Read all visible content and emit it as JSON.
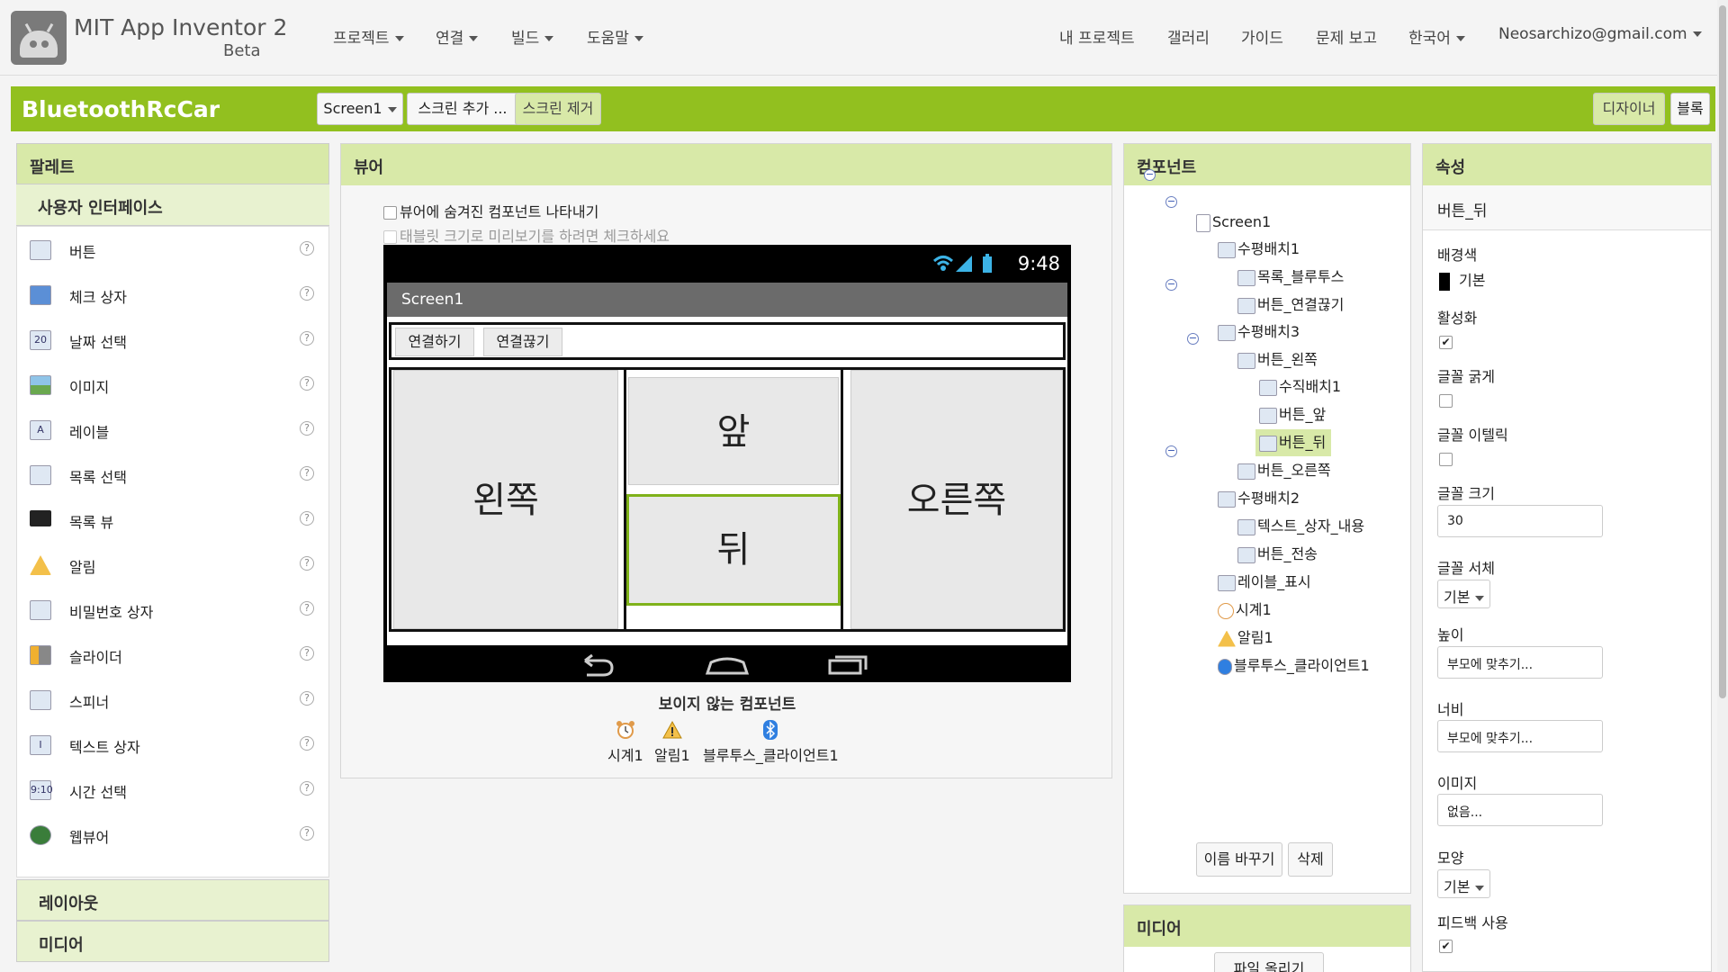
{
  "header": {
    "app_title": "MIT App Inventor 2",
    "app_subtitle": "Beta",
    "menus": [
      "프로젝트",
      "연결",
      "빌드",
      "도움말"
    ],
    "links": [
      "내 프로젝트",
      "갤러리",
      "가이드",
      "문제 보고"
    ],
    "language": "한국어",
    "account": "Neosarchizo@gmail.com"
  },
  "projbar": {
    "project_name": "BluetoothRcCar",
    "screen_select": "Screen1",
    "add_screen": "스크린 추가 ...",
    "remove_screen": "스크린 제거",
    "designer": "디자이너",
    "blocks": "블록"
  },
  "palette": {
    "title": "팔레트",
    "category_open": "사용자 인터페이스",
    "items": [
      {
        "label": "버튼",
        "icon": "button-icon"
      },
      {
        "label": "체크 상자",
        "icon": "checkbox-icon"
      },
      {
        "label": "날짜 선택",
        "icon": "datepicker-icon"
      },
      {
        "label": "이미지",
        "icon": "image-icon"
      },
      {
        "label": "레이블",
        "icon": "label-icon"
      },
      {
        "label": "목록 선택",
        "icon": "listpicker-icon"
      },
      {
        "label": "목록 뷰",
        "icon": "listview-icon"
      },
      {
        "label": "알림",
        "icon": "notifier-icon"
      },
      {
        "label": "비밀번호 상자",
        "icon": "password-icon"
      },
      {
        "label": "슬라이더",
        "icon": "slider-icon"
      },
      {
        "label": "스피너",
        "icon": "spinner-icon"
      },
      {
        "label": "텍스트 상자",
        "icon": "textbox-icon"
      },
      {
        "label": "시간 선택",
        "icon": "timepicker-icon"
      },
      {
        "label": "웹뷰어",
        "icon": "webviewer-icon"
      }
    ],
    "help_glyph": "?",
    "cat_layout": "레이아웃",
    "cat_media": "미디어"
  },
  "viewer": {
    "title": "뷰어",
    "opt_hidden": "뷰어에 숨겨진 컴포넌트 나타내기",
    "opt_tablet": "태블릿 크기로 미리보기를 하려면 체크하세요",
    "time": "9:48",
    "screen_title": "Screen1",
    "btn_connect": "연결하기",
    "btn_disconnect": "연결끊기",
    "btn_left": "왼쪽",
    "btn_front": "앞",
    "btn_back": "뒤",
    "btn_right": "오른쪽",
    "invisible_title": "보이지 않는 컴포넌트",
    "invisible": [
      "시계1",
      "알림1",
      "블루투스_클라이언트1"
    ]
  },
  "components": {
    "title": "컴포넌트",
    "tree": [
      {
        "label": "Screen1",
        "icon": "screen-icon"
      },
      {
        "label": "수평배치1",
        "icon": "horizontal-arrangement-icon"
      },
      {
        "label": "목록_블루투스",
        "icon": "listpicker-icon"
      },
      {
        "label": "버튼_연결끊기",
        "icon": "button-icon"
      },
      {
        "label": "수평배치3",
        "icon": "horizontal-arrangement-icon"
      },
      {
        "label": "버튼_왼쪽",
        "icon": "button-icon"
      },
      {
        "label": "수직배치1",
        "icon": "vertical-arrangement-icon"
      },
      {
        "label": "버튼_앞",
        "icon": "button-icon"
      },
      {
        "label": "버튼_뒤",
        "icon": "button-icon"
      },
      {
        "label": "버튼_오른쪽",
        "icon": "button-icon"
      },
      {
        "label": "수평배치2",
        "icon": "horizontal-arrangement-icon"
      },
      {
        "label": "텍스트_상자_내용",
        "icon": "textbox-icon"
      },
      {
        "label": "버튼_전송",
        "icon": "button-icon"
      },
      {
        "label": "레이블_표시",
        "icon": "label-icon"
      },
      {
        "label": "시계1",
        "icon": "clock-icon"
      },
      {
        "label": "알림1",
        "icon": "notifier-icon"
      },
      {
        "label": "블루투스_클라이언트1",
        "icon": "bluetooth-icon"
      }
    ],
    "toggle_glyph": "−",
    "rename": "이름 바꾸기",
    "delete": "삭제",
    "media_title": "미디어",
    "upload": "파일 올리기"
  },
  "properties": {
    "title": "속성",
    "component": "버튼_뒤",
    "bg_label": "배경색",
    "bg_value": "기본",
    "enabled_label": "활성화",
    "bold_label": "글꼴 굵게",
    "italic_label": "글꼴 이텔릭",
    "fontsize_label": "글꼴 크기",
    "fontsize_value": "30",
    "typeface_label": "글꼴 서체",
    "typeface_value": "기본",
    "height_label": "높이",
    "height_value": "부모에 맞추기...",
    "width_label": "너비",
    "width_value": "부모에 맞추기...",
    "image_label": "이미지",
    "image_value": "없음...",
    "shape_label": "모양",
    "shape_value": "기본",
    "feedback_label": "피드백 사용",
    "check_mark": "✔"
  },
  "colors": {
    "accent_green": "#92c01f",
    "panel_header": "#d8e9a8",
    "selected_button_border": "#7fb21a"
  }
}
